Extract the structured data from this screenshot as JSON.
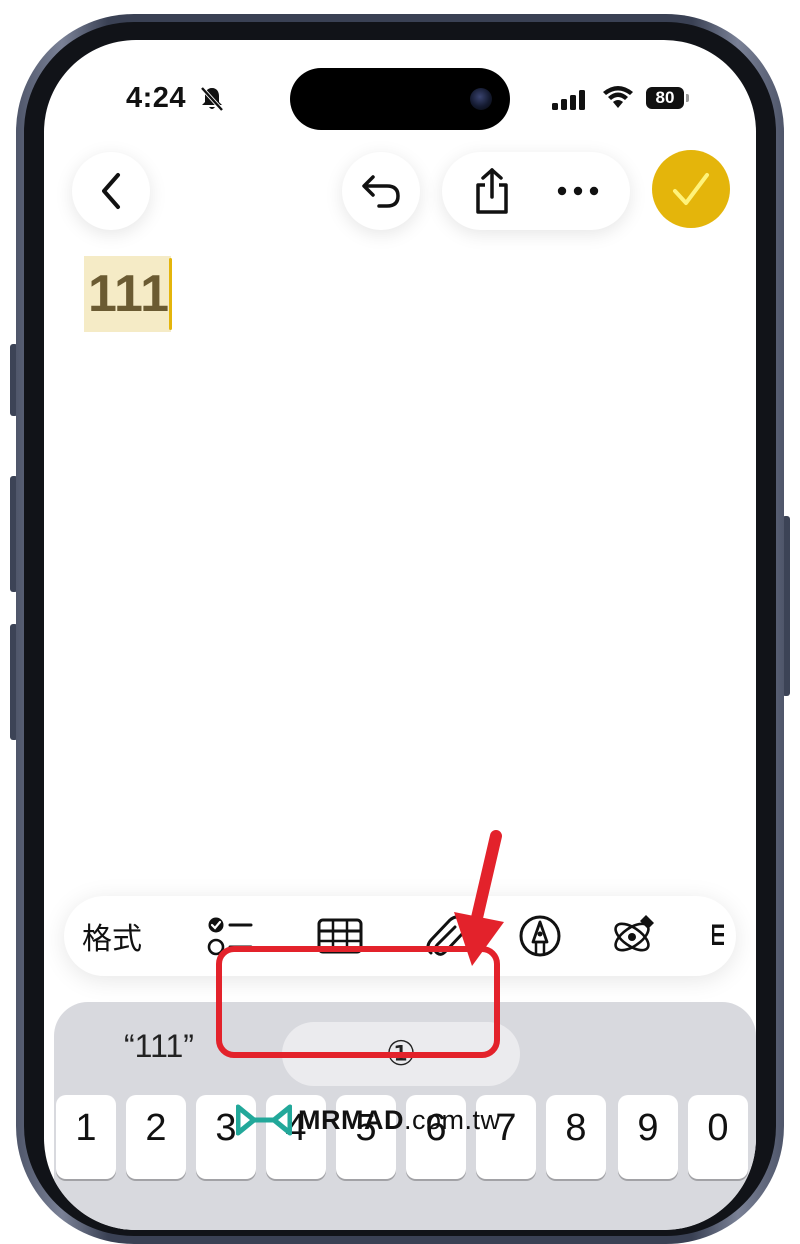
{
  "status_bar": {
    "time": "4:24",
    "battery": "80",
    "icons": [
      "bell-slash-icon",
      "cellular-signal-icon",
      "wifi-icon",
      "battery-icon"
    ]
  },
  "nav": {
    "icons": [
      "chevron-left-icon",
      "undo-icon",
      "share-icon",
      "more-icon",
      "checkmark-icon"
    ],
    "done_color": "#e4b50b"
  },
  "note": {
    "text": "111",
    "highlight_color": "#f5ebc6"
  },
  "toolbar": {
    "format_label": "格式",
    "icons": [
      "checklist-icon",
      "table-icon",
      "paperclip-icon",
      "markup-pen-icon",
      "apple-intelligence-icon"
    ],
    "truncated_label": "E"
  },
  "keyboard": {
    "suggestions": [
      "“111”",
      "①"
    ],
    "keys": [
      "1",
      "2",
      "3",
      "4",
      "5",
      "6",
      "7",
      "8",
      "9",
      "0"
    ]
  },
  "annotation": {
    "color": "#e3222b",
    "icons": [
      "red-arrow-icon",
      "highlight-box"
    ]
  },
  "watermark": {
    "brand": "MRMAD",
    "domain": ".com.tw"
  }
}
